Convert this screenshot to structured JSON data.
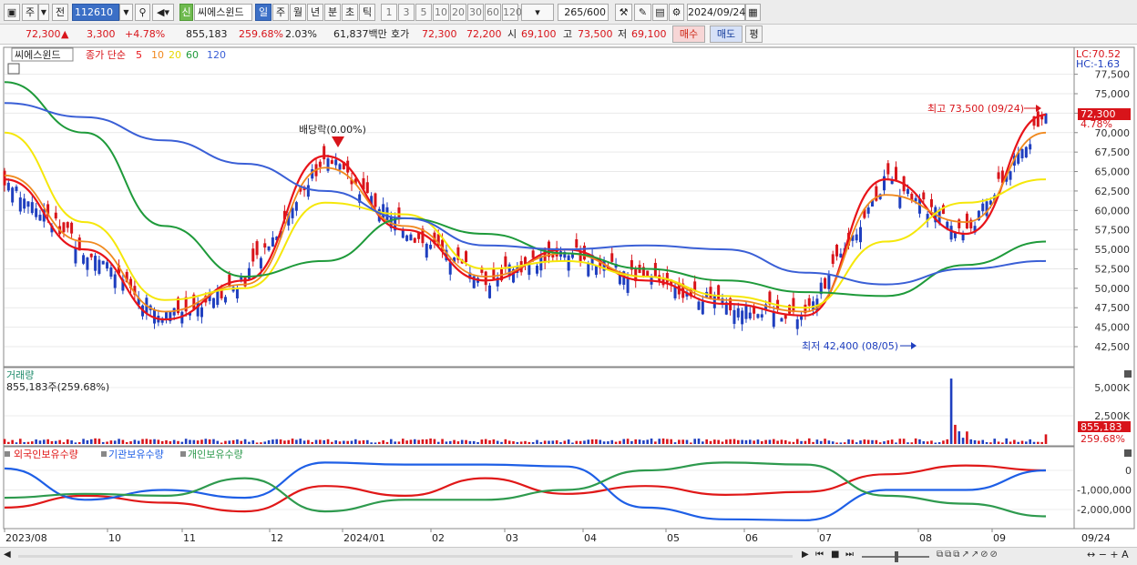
{
  "toolbar": {
    "period_type": "주",
    "compare": "전",
    "stock_code": "112610",
    "stock_badge": "신",
    "stock_name": "씨에스윈드",
    "periods": [
      "일",
      "주",
      "월",
      "년",
      "분",
      "초",
      "틱"
    ],
    "active_period": "일",
    "intervals": [
      "1",
      "3",
      "5",
      "10",
      "20",
      "30",
      "60",
      "120"
    ],
    "count": "265",
    "count_total": "/600",
    "date": "2024/09/24"
  },
  "infobar": {
    "price": "72,300",
    "change": "3,300",
    "change_pct": "+4.78%",
    "volume": "855,183",
    "volume_ratio": "259.68%",
    "turnover": "2.03%",
    "trade_value": "61,837백만",
    "ask_label": "호가",
    "ask": "72,300",
    "bid": "72,200",
    "open_label": "시",
    "open": "69,100",
    "high_label": "고",
    "high": "73,500",
    "low_label": "저",
    "low": "69,100",
    "buy_label": "매수",
    "sell_label": "매도",
    "eval_label": "평"
  },
  "price_panel": {
    "name_tag": "씨에스윈드",
    "ma_label": "종가 단순",
    "ma_periods": [
      "5",
      "10",
      "20",
      "60",
      "120"
    ],
    "lc_label": "LC:70.52",
    "hc_label": "HC:-1.63",
    "last_price_tag": "72,300",
    "last_pct_tag": "4.78%",
    "high_annotation": "최고 73,500 (09/24)",
    "low_annotation": "최저 42,400 (08/05)",
    "dividend_annotation": "배당락(0.00%)",
    "price_ticks": [
      "77,500",
      "75,000",
      "72,500",
      "70,000",
      "67,500",
      "65,000",
      "62,500",
      "60,000",
      "57,500",
      "55,000",
      "52,500",
      "50,000",
      "47,500",
      "45,000",
      "42,500"
    ]
  },
  "volume_panel": {
    "title": "거래량",
    "value": "855,183주(259.68%)",
    "ticks": [
      "5,000K",
      "2,500K"
    ],
    "last_tag": "855,183",
    "last_pct_tag": "259.68%"
  },
  "holdings_panel": {
    "legend": [
      "외국인보유수량",
      "기관보유수량",
      "개인보유수량"
    ],
    "ticks": [
      "0",
      "-1,000,000",
      "-2,000,000"
    ]
  },
  "x_axis": {
    "labels": [
      "2023/08",
      "10",
      "11",
      "12",
      "2024/01",
      "02",
      "03",
      "04",
      "05",
      "06",
      "07",
      "08",
      "09"
    ],
    "right_label": "09/24"
  },
  "colors": {
    "up": "#d8141a",
    "down": "#1f3fbf",
    "ma5": "#e8141a",
    "ma10": "#f0891e",
    "ma20": "#f5e70a",
    "ma60": "#1e9a3a",
    "ma120": "#3a5fd6",
    "foreign": "#e01818",
    "institution": "#1e5fe6",
    "individual": "#2e9a4e"
  },
  "chart_data": [
    {
      "type": "line",
      "title": "씨에스윈드",
      "x": [
        "2023/08",
        "10",
        "11",
        "12",
        "2024/01",
        "02",
        "03",
        "04",
        "05",
        "06",
        "07",
        "08",
        "09",
        "09/24"
      ],
      "series": [
        {
          "name": "5",
          "values": [
            64000,
            55000,
            46000,
            51000,
            67000,
            57500,
            51000,
            55000,
            51000,
            48000,
            46500,
            64000,
            57000,
            72300
          ]
        },
        {
          "name": "10",
          "values": [
            64500,
            56000,
            47000,
            50500,
            65500,
            58000,
            51500,
            54500,
            51500,
            48500,
            47000,
            62000,
            58500,
            70000
          ]
        },
        {
          "name": "20",
          "values": [
            70000,
            58500,
            48500,
            50000,
            61000,
            59500,
            52500,
            53500,
            51500,
            49000,
            47500,
            56000,
            61000,
            64000
          ]
        },
        {
          "name": "60",
          "values": [
            76500,
            70000,
            58000,
            51500,
            53500,
            59000,
            57000,
            54500,
            52500,
            51000,
            49500,
            49000,
            53000,
            56000
          ]
        },
        {
          "name": "120",
          "values": [
            73800,
            72000,
            69000,
            66000,
            62500,
            59000,
            55500,
            55000,
            55500,
            55000,
            52000,
            50500,
            52500,
            53500
          ]
        }
      ],
      "high": {
        "value": 73500,
        "date": "09/24"
      },
      "low": {
        "value": 42400,
        "date": "08/05"
      },
      "ylim": [
        41500,
        78000
      ]
    },
    {
      "type": "bar",
      "title": "거래량",
      "last_value": 855183,
      "last_pct": 259.68,
      "ylim": [
        0,
        6000000
      ]
    },
    {
      "type": "line",
      "series": [
        {
          "name": "외국인보유수량",
          "values": [
            -1900000,
            -1300000,
            -1650000,
            -2100000,
            -800000,
            -1300000,
            -400000,
            -1200000,
            -800000,
            -1250000,
            -1100000,
            -200000,
            250000,
            0
          ]
        },
        {
          "name": "기관보유수량",
          "values": [
            100000,
            -1500000,
            -1000000,
            -1400000,
            400000,
            300000,
            300000,
            200000,
            -1900000,
            -2500000,
            -2550000,
            -1000000,
            -1000000,
            0
          ]
        },
        {
          "name": "개인보유수량",
          "values": [
            -1400000,
            -1200000,
            -1300000,
            -400000,
            -2100000,
            -1500000,
            -1500000,
            -1000000,
            0,
            400000,
            300000,
            -1300000,
            -1700000,
            -2350000
          ]
        }
      ],
      "ylim": [
        -2700000,
        600000
      ]
    }
  ]
}
